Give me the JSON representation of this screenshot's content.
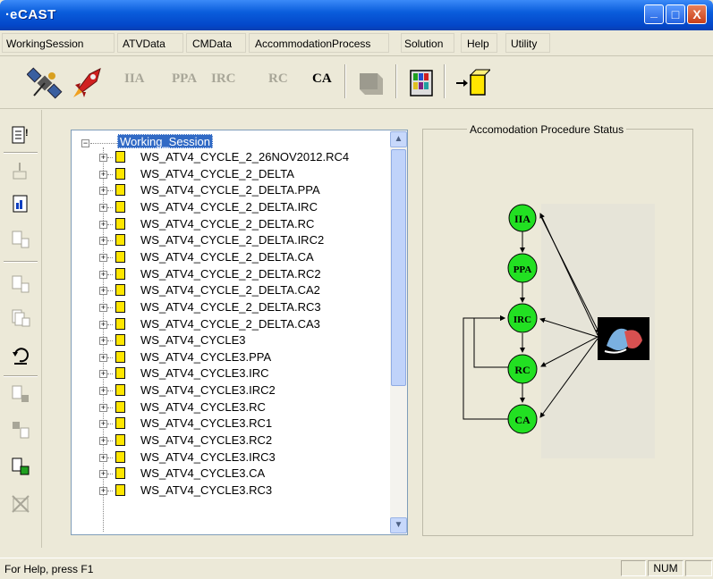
{
  "window": {
    "title": "CAST",
    "minimize": "_",
    "maximize": "□",
    "close": "X"
  },
  "menu": [
    "WorkingSession",
    "ATVData",
    "CMData",
    "AccommodationProcess",
    "Solution",
    "Help",
    "Utility"
  ],
  "toolbar": {
    "buttons": [
      "IIA",
      "PPA",
      "IRC",
      "RC",
      "CA"
    ]
  },
  "tree": {
    "root": "Working_Session",
    "items": [
      "WS_ATV4_CYCLE_2_26NOV2012.RC4",
      "WS_ATV4_CYCLE_2_DELTA",
      "WS_ATV4_CYCLE_2_DELTA.PPA",
      "WS_ATV4_CYCLE_2_DELTA.IRC",
      "WS_ATV4_CYCLE_2_DELTA.RC",
      "WS_ATV4_CYCLE_2_DELTA.IRC2",
      "WS_ATV4_CYCLE_2_DELTA.CA",
      "WS_ATV4_CYCLE_2_DELTA.RC2",
      "WS_ATV4_CYCLE_2_DELTA.CA2",
      "WS_ATV4_CYCLE_2_DELTA.RC3",
      "WS_ATV4_CYCLE_2_DELTA.CA3",
      "WS_ATV4_CYCLE3",
      "WS_ATV4_CYCLE3.PPA",
      "WS_ATV4_CYCLE3.IRC",
      "WS_ATV4_CYCLE3.IRC2",
      "WS_ATV4_CYCLE3.RC",
      "WS_ATV4_CYCLE3.RC1",
      "WS_ATV4_CYCLE3.RC2",
      "WS_ATV4_CYCLE3.IRC3",
      "WS_ATV4_CYCLE3.CA",
      "WS_ATV4_CYCLE3.RC3"
    ]
  },
  "status_panel": {
    "title": "Accomodation Procedure Status",
    "nodes": [
      "IIA",
      "PPA",
      "IRC",
      "RC",
      "CA"
    ],
    "node_color": "#22e022"
  },
  "statusbar": {
    "help": "For Help, press F1",
    "num": "NUM"
  },
  "colors": {
    "titlebar": "#0a5ddc",
    "selection": "#316ac5",
    "folder": "#ffe600"
  }
}
